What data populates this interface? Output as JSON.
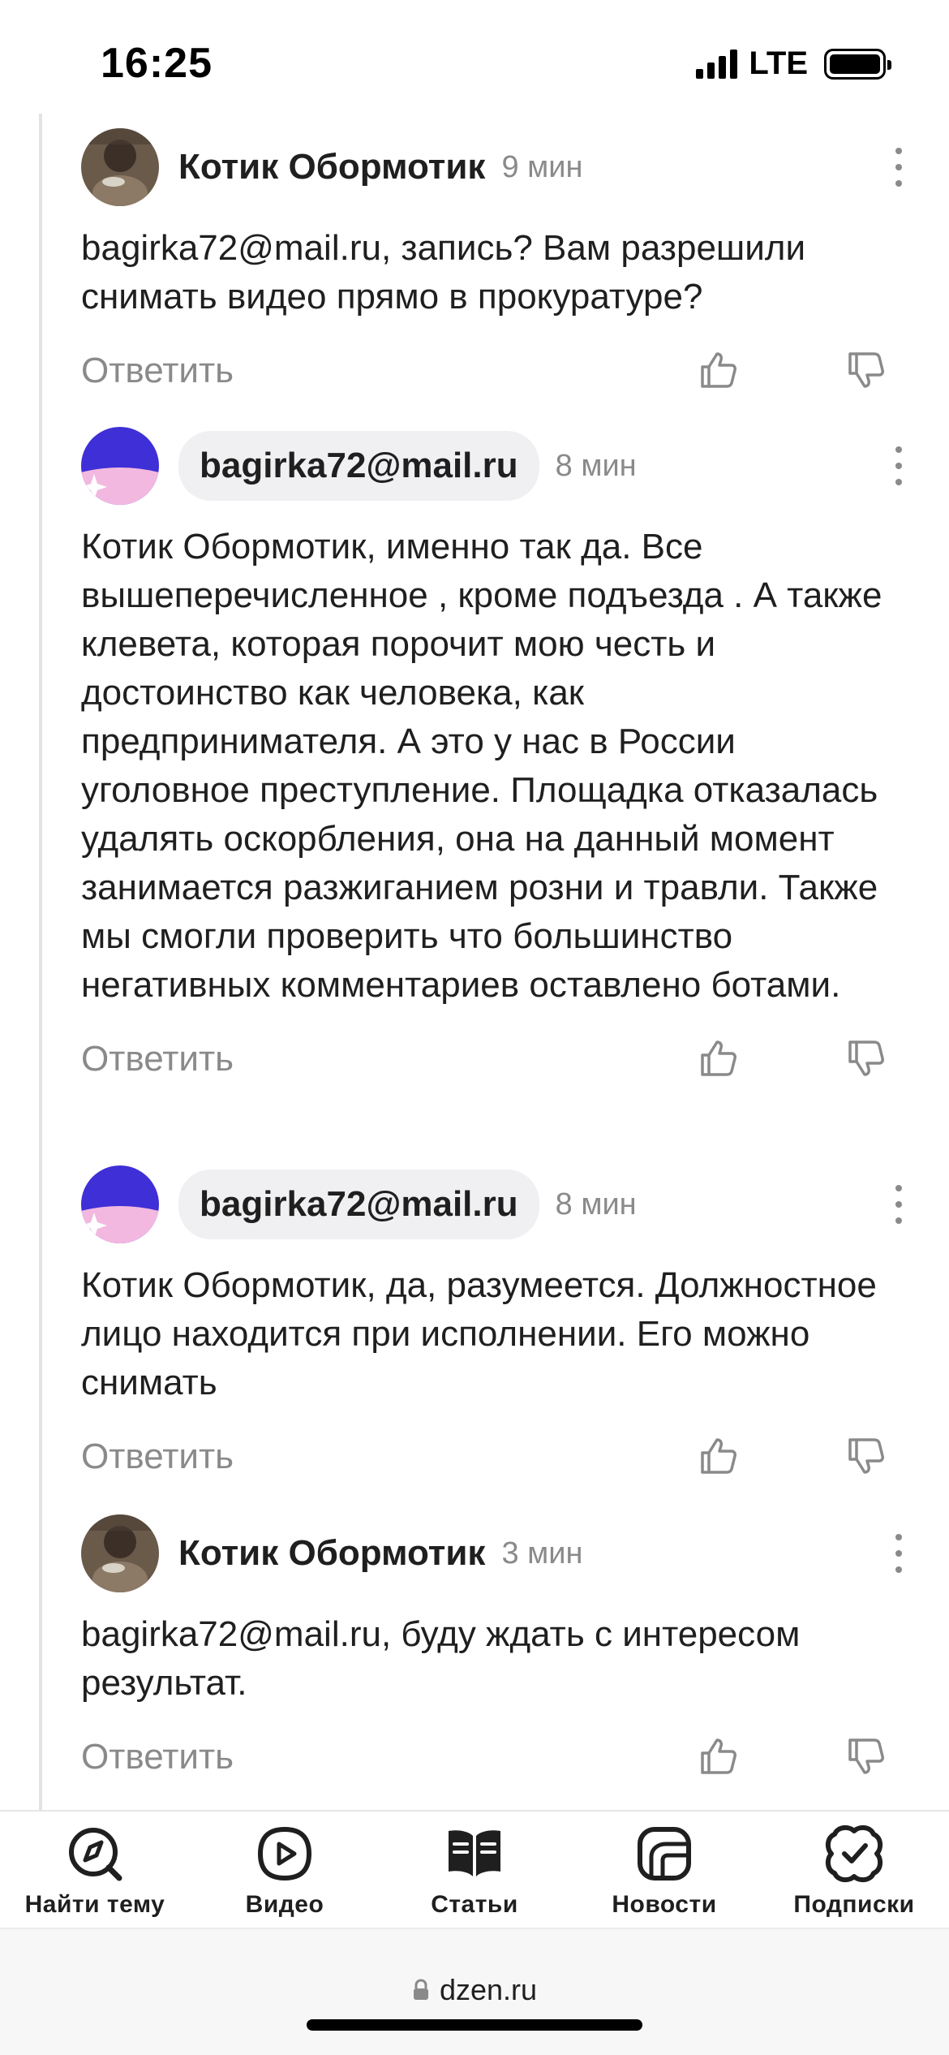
{
  "status_bar": {
    "time": "16:25",
    "network": "LTE"
  },
  "comments": [
    {
      "author": "Котик Обормотик",
      "time": "9 мин",
      "text": "bagirka72@mail.ru, запись? Вам разрешили снимать видео прямо в прокуратуре?",
      "reply_label": "Ответить"
    },
    {
      "author": "bagirka72@mail.ru",
      "time": "8 мин",
      "text": "Котик Обормотик, именно так да. Все вышеперечисленное , кроме подъезда . А также клевета, которая порочит мою честь и достоинство как человека, как предпринимателя. А это у нас в России уголовное преступление. Площадка отказалась удалять оскорбления, она на данный момент занимается разжиганием розни и травли. Также мы смогли проверить что большинство негативных комментариев оставлено ботами.",
      "reply_label": "Ответить"
    },
    {
      "author": "bagirka72@mail.ru",
      "time": "8 мин",
      "text": "Котик Обормотик, да, разумеется. Должностное лицо находится при исполнении. Его можно снимать",
      "reply_label": "Ответить"
    },
    {
      "author": "Котик Обормотик",
      "time": "3 мин",
      "text": "bagirka72@mail.ru, буду ждать с интересом результат.",
      "reply_label": "Ответить"
    }
  ],
  "nav": {
    "items": [
      {
        "label": "Найти тему",
        "icon": "compass-search-icon"
      },
      {
        "label": "Видео",
        "icon": "video-play-icon"
      },
      {
        "label": "Статьи",
        "icon": "articles-icon"
      },
      {
        "label": "Новости",
        "icon": "news-icon"
      },
      {
        "label": "Подписки",
        "icon": "subscriptions-icon"
      }
    ]
  },
  "browser": {
    "url": "dzen.ru"
  },
  "colors": {
    "muted": "#8a8a8a",
    "chip_bg": "#f0f0f2",
    "brand_blue": "#3f2fd6",
    "brand_pink": "#f2b8e0"
  }
}
